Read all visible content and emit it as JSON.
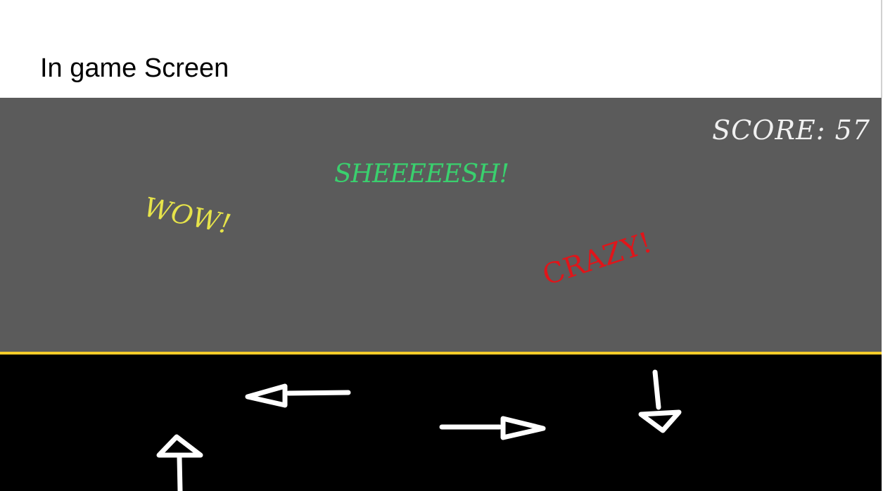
{
  "page": {
    "heading": "In game Screen"
  },
  "game": {
    "score_text": "SCORE: 57",
    "praises": {
      "sheesh": "SHEEEEESH!",
      "wow": "WOW!",
      "crazy": "CRAZY!"
    },
    "arrows": [
      {
        "direction": "left",
        "icon": "arrow-left-icon"
      },
      {
        "direction": "right",
        "icon": "arrow-right-icon"
      },
      {
        "direction": "down",
        "icon": "arrow-down-icon"
      },
      {
        "direction": "up",
        "icon": "arrow-up-icon"
      }
    ],
    "colors": {
      "playfield": "#5b5b5b",
      "lane": "#000000",
      "lane_line": "#f5cc2a",
      "score": "#f0f0f0",
      "sheesh": "#3ad06e",
      "wow": "#e6e34a",
      "crazy": "#e0151a",
      "arrow": "#ffffff"
    }
  }
}
